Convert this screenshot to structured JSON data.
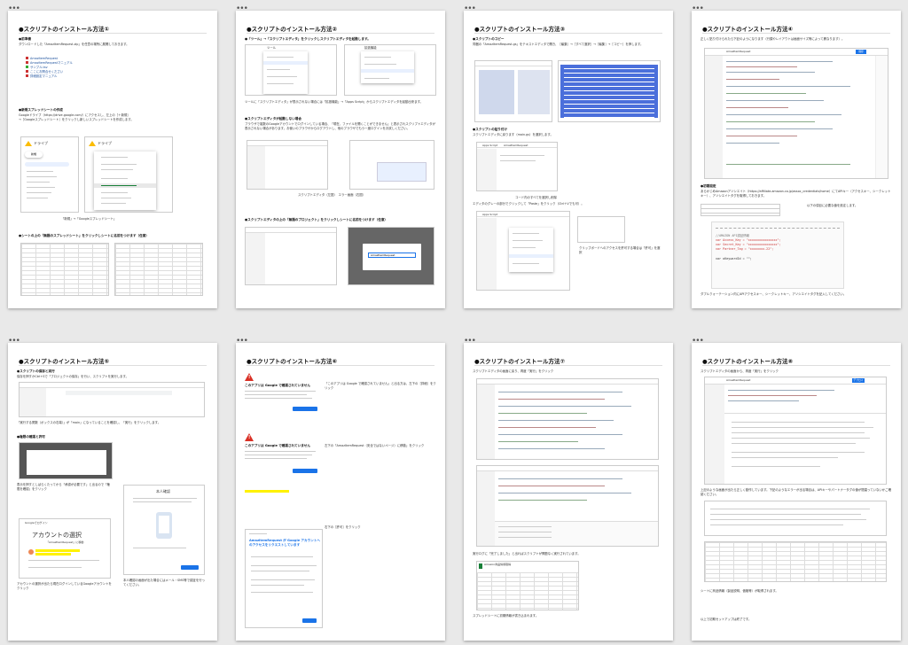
{
  "page_dots": "•••",
  "slides": [
    {
      "title": "●スクリプトのインストール方法①",
      "lines": [
        "●前準備",
        "ダウンロードした「AmazItemRequest.zip」を任意の場所に展開しておきます。",
        "●新規スプレッドシートの作成",
        "Googleドライブ（https://drive.google.com/）にアクセスし、左上の［＋新規］",
        "→［Googleスプレッドシート］をクリックし新しいスプレッドシートを作成します。",
        "「新規」→「Googleスプレッドシート」",
        "●シートの上の「無題のスプレッドシート」をクリックしシートに名前をつけます（任意）"
      ],
      "files": [
        "AmazItemRequest",
        "AmazItemRequestマニュアル",
        "サンプル.tsv",
        "ここにお問合せください",
        "詳細設定マニュアル"
      ],
      "drive_label": "ドライブ",
      "new_label": "新規"
    },
    {
      "title": "●スクリプトのインストール方法②",
      "lines": [
        "●「ツール」→「スクリプトエディタ」をクリックしスクリプトエディタを起動します。",
        "ツールに「スクリプトエディタ」が表示されない場合には「拡張機能」→「Apps Script」からスクリプトエディタを起動出来ます。",
        "●スクリプトエディタが起動しない場合",
        "ブラウザで複数のGoogleアカウントでログインしている場合、「現在、ファイルを開くことができません」と表示されスクリプトエディタが表示されない場合があります。お使いのブラウザからログアウトし、他のブラウザでもう一度ログインをお試しください。",
        "スクリプトエディタ（左図）　エラー画面（右図）",
        "●スクリプトエディタの上の「無題のプロジェクト」をクリックしシートに名前をつけます（任意）"
      ],
      "menu_items": [
        "ツール",
        "拡張機能"
      ],
      "project_name": "AmazItemRequest"
    },
    {
      "title": "●スクリプトのインストール方法③",
      "lines": [
        "●スクリプトのコピー",
        "同梱の「AmazItemRequest.gs」をテキストエディタで開き、［編集］→［すべて選択］→［編集］→［コピー］を押します。",
        "●スクリプトの貼り付け",
        "スクリプトエディタに戻ります（main.gs）を選択します。",
        "コード内のすべてを選択し削除",
        "エディタのグレーの部分でクリックして「Paste」をクリック（Ctrl＋Vでも可）。",
        "クリップボードへのアクセスを許可する場合は「許可」を選択"
      ],
      "editor_title": "Apps Script",
      "editor_project": "AmazItemRequest"
    },
    {
      "title": "●スクリプトのインストール方法④",
      "lines": [
        "正しく貼り付けられたら下記のようになります（行頭やレイアウトは画面サイズ等によって異なります）。",
        "●初期設定",
        "あらかじめAmazonアソシエイト（https://affiliate.amazon.co.jp/assoc_credentials/home）にてAPIキー（アクセスキー、シークレットキー）、アソシエイトタグを取得しておきます。",
        "以下の項目に必要な値を設定します。",
        "ダブルクォーテーション内にAPIアクセスキー、シークレットキー、アソシエイトタグを記入してください。"
      ],
      "code_lines": [
        "//AMAZON API認証情報",
        "var Access_Key = \"xxxxxxxxxxxxxxxx\";",
        "var Secret_Key = \"xxxxxxxxxxxxxxxx\";",
        "var Partner_Tag = \"xxxxxxxx-22\";",
        "var oKeywordId = \"\";"
      ],
      "editor_project": "AmazItemRequest",
      "save_label": "保存"
    },
    {
      "title": "●スクリプトのインストール方法⑤",
      "lines": [
        "●スクリプトの保存と実行",
        "保存を押すかCtrl+Sで「プロジェクトの保存」を行い、スクリプトを実行します。",
        "「実行する関数（ボックスの右端）」が「main」になっていることを確認し、「実行」をクリックします。",
        "●権限の確認と許可",
        "表示を押すとしばらくたってから「承認が必要です」と出るので「権限を確認」をクリック",
        "アカウントの選択",
        "アカウントの選択が出たら現在ログインしているGoogleアカウントをクリック",
        "本人確認の画面が出た場合にはメール・SMS等で認証を行ってください。"
      ],
      "account_header": "Googleでログイン",
      "account_title": "アカウントの選択",
      "account_sub": "「AmazItemRequest」に移動",
      "verify_title": "本人確認"
    },
    {
      "title": "●スクリプトのインストール方法⑥",
      "warn_title": "このアプリは Google で確認されていません",
      "lines": [
        "「このアプリは Google で確認されていません」と出る方は、左下の［詳細］をクリック",
        "左下の「AmazItemRequest（安全ではないページ）に移動」をクリック",
        "右下の［許可］をクリック"
      ],
      "consent_title": "AmazItemRequest が Google アカウントへのアクセスをリクエストしています",
      "back_button": "安全なページに戻る",
      "allow_button": "許可"
    },
    {
      "title": "●スクリプトのインストール方法⑦",
      "lines": [
        "スクリプトエディタの画面に戻り、再度「実行」をクリック",
        "実行ログに「完了しました」と出ればスクリプトが問題なく実行されています。",
        "スプレッドシートに初期情報が書き込まれます。"
      ],
      "sheet_name": "Amazon商品情報取得"
    },
    {
      "title": "●スクリプトのインストール方法⑧",
      "lines": [
        "スクリプトエディタの画面から、再度「実行」をクリック",
        "上記のような画面が出たら正しく動作しています。下記のようなエラーが出る場合は、APIキーやパートナータグの値が間違っていないかご確認ください。",
        "シートに商品情報（製品説明、価格等）が取得されます。",
        "以上で初期セットアップは終了です。"
      ],
      "editor_project": "AmazItemRequest",
      "deploy_label": "デプロイ"
    }
  ]
}
